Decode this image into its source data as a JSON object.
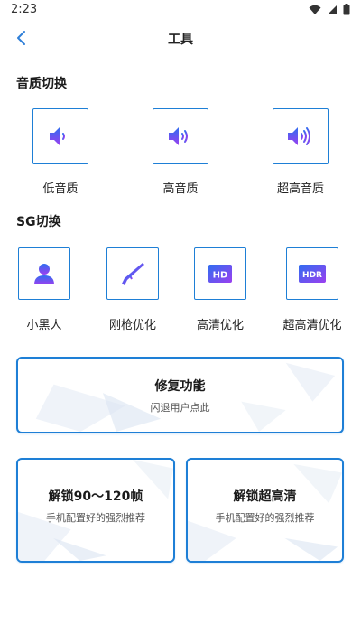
{
  "status_bar": {
    "time": "2:23"
  },
  "header": {
    "title": "工具"
  },
  "audio_section": {
    "title": "音质切换",
    "items": [
      {
        "label": "低音质",
        "icon": "speaker-low-icon"
      },
      {
        "label": "高音质",
        "icon": "speaker-medium-icon"
      },
      {
        "label": "超高音质",
        "icon": "speaker-high-icon"
      }
    ]
  },
  "sg_section": {
    "title": "SG切换",
    "items": [
      {
        "label": "小黑人",
        "icon": "person-icon"
      },
      {
        "label": "刚枪优化",
        "icon": "rifle-icon"
      },
      {
        "label": "高清优化",
        "icon": "hd-icon",
        "badge": "HD"
      },
      {
        "label": "超高清优化",
        "icon": "hdr-icon",
        "badge": "HDR"
      }
    ]
  },
  "repair_card": {
    "title": "修复功能",
    "subtitle": "闪退用户点此"
  },
  "unlock_fps_card": {
    "title": "解锁90～120帧",
    "subtitle": "手机配置好的强烈推荐"
  },
  "unlock_hd_card": {
    "title": "解锁超高清",
    "subtitle": "手机配置好的强烈推荐"
  },
  "colors": {
    "accent": "#1e7fd6",
    "icon_gradient_start": "#2f6df0",
    "icon_gradient_end": "#9b3ff0"
  }
}
